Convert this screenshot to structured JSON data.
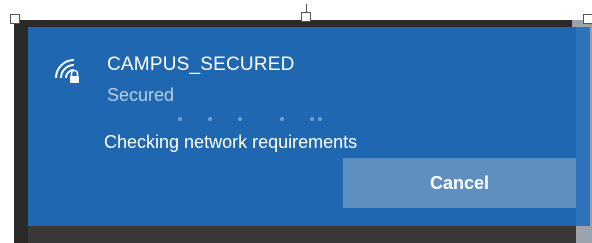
{
  "network": {
    "name": "CAMPUS_SECURED",
    "status": "Secured",
    "icon": "wifi-secured-icon"
  },
  "progress": {
    "message": "Checking network requirements",
    "state": "indeterminate"
  },
  "actions": {
    "cancel_label": "Cancel"
  },
  "colors": {
    "flyout_background": "#1f67b1",
    "button_background": "#5f8fbf",
    "text_primary": "#ffffff",
    "text_secondary": "#b9cfe6"
  }
}
